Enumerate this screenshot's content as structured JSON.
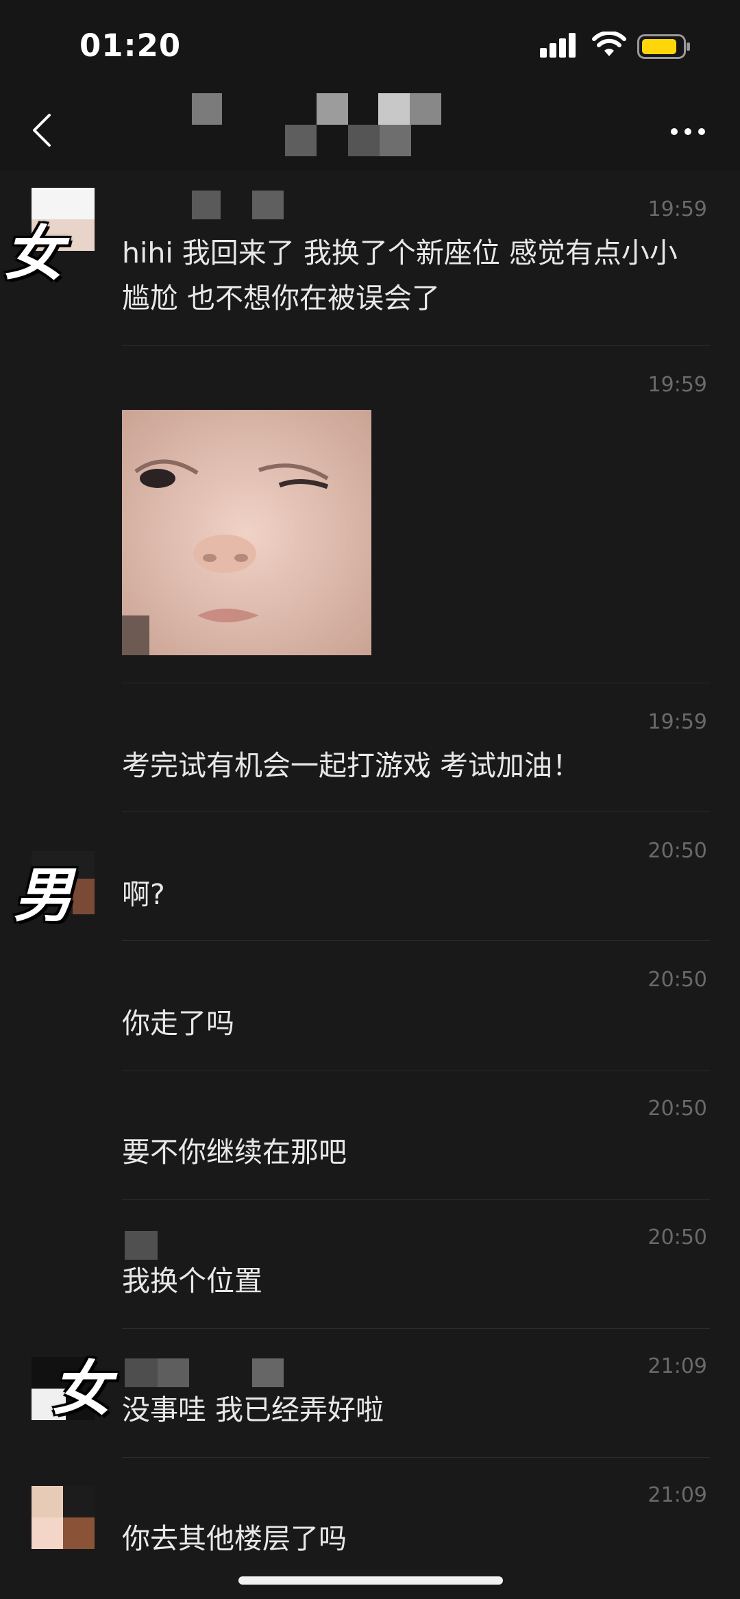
{
  "status_bar": {
    "time": "01:20"
  },
  "nav": {
    "back_icon": "chevron-left-icon",
    "more_icon": "ellipsis-icon"
  },
  "overlay_labels": {
    "female": "女",
    "male": "男"
  },
  "messages": [
    {
      "time": "19:59",
      "text": "hihi 我回来了 我换了个新座位 感觉有点小小尴尬 也不想你在被误会了"
    },
    {
      "time": "19:59",
      "sticker": "baby-grimace-sticker"
    },
    {
      "time": "19:59",
      "text": "考完试有机会一起打游戏 考试加油！"
    },
    {
      "time": "20:50",
      "text": "啊?"
    },
    {
      "time": "20:50",
      "text": "你走了吗"
    },
    {
      "time": "20:50",
      "text": "要不你继续在那吧"
    },
    {
      "time": "20:50",
      "text": "我换个位置"
    },
    {
      "time": "21:09",
      "text": "没事哇 我已经弄好啦"
    },
    {
      "time": "21:09",
      "text": "你去其他楼层了吗"
    }
  ],
  "colors": {
    "background": "#191919",
    "text": "#e8e8e8",
    "timestamp": "#6a6a6a"
  }
}
